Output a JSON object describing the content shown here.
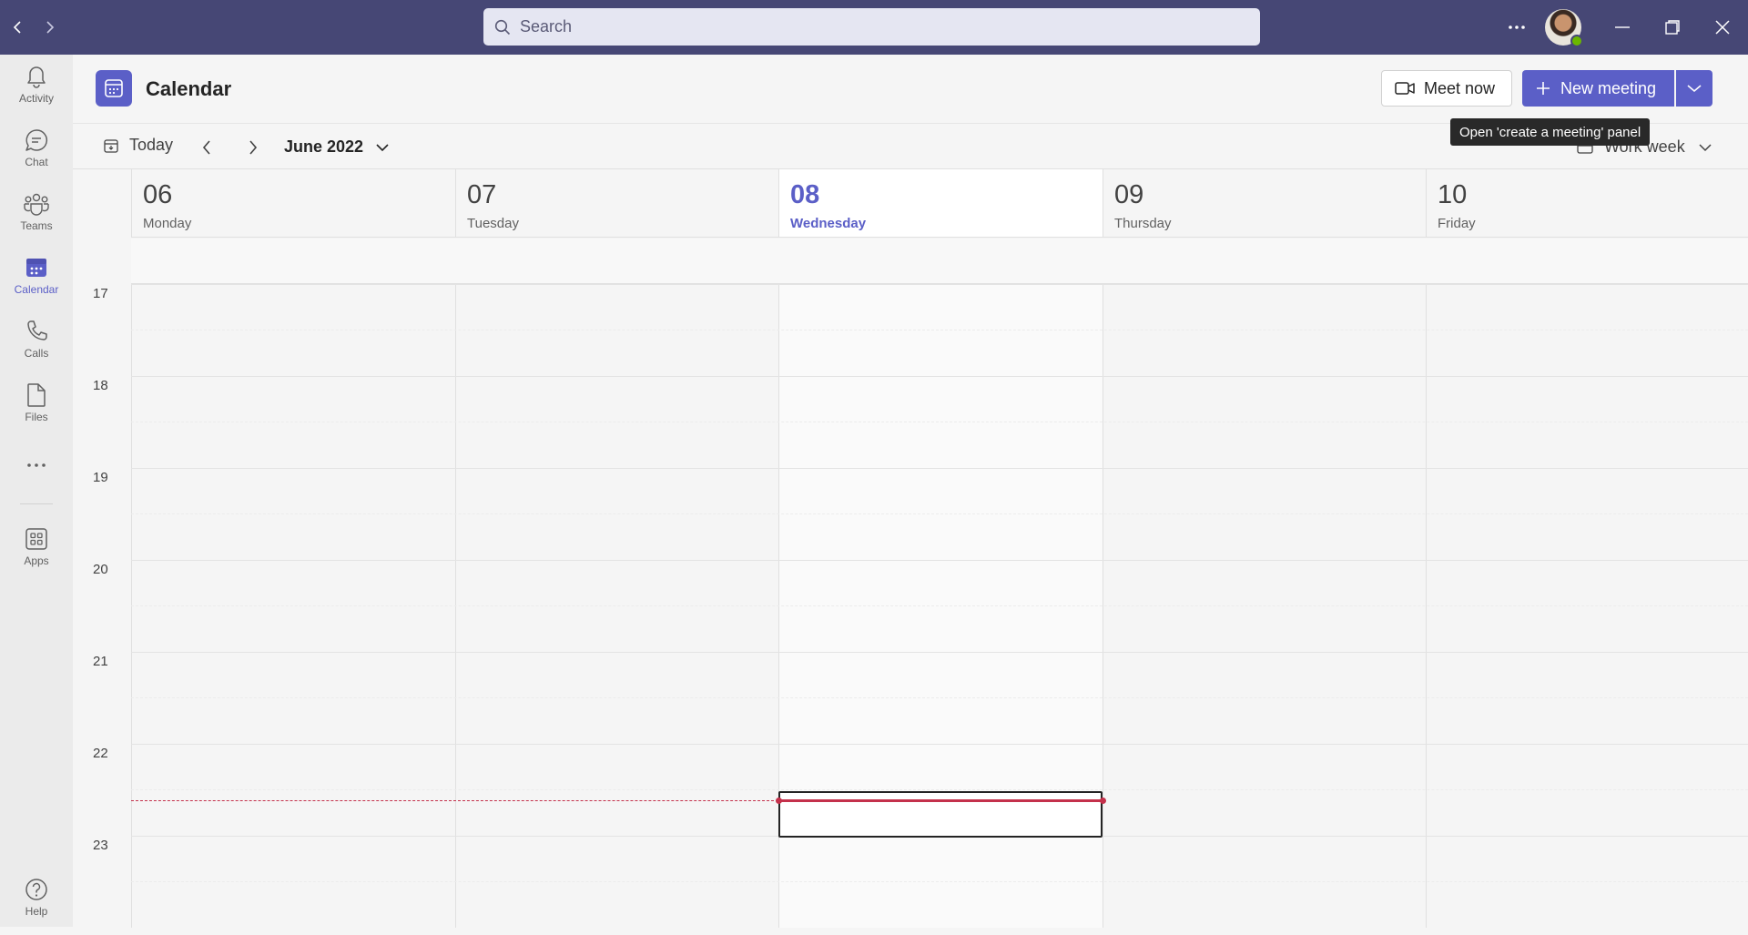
{
  "titlebar": {
    "search_placeholder": "Search",
    "accent": "#464775"
  },
  "rail": {
    "items": [
      {
        "label": "Activity",
        "icon": "bell-icon"
      },
      {
        "label": "Chat",
        "icon": "chat-icon"
      },
      {
        "label": "Teams",
        "icon": "teams-icon"
      },
      {
        "label": "Calendar",
        "icon": "calendar-icon",
        "active": true
      },
      {
        "label": "Calls",
        "icon": "phone-icon"
      },
      {
        "label": "Files",
        "icon": "file-icon"
      },
      {
        "label": "Apps",
        "icon": "apps-icon"
      },
      {
        "label": "Help",
        "icon": "help-icon"
      }
    ]
  },
  "header": {
    "title": "Calendar",
    "meet_now": "Meet now",
    "new_meeting": "New meeting",
    "tooltip": "Open 'create a meeting' panel"
  },
  "toolbar": {
    "today": "Today",
    "month": "June 2022",
    "view": "Work week"
  },
  "days": [
    {
      "num": "06",
      "name": "Monday"
    },
    {
      "num": "07",
      "name": "Tuesday"
    },
    {
      "num": "08",
      "name": "Wednesday",
      "today": true
    },
    {
      "num": "09",
      "name": "Thursday"
    },
    {
      "num": "10",
      "name": "Friday"
    }
  ],
  "hours": [
    "17",
    "18",
    "19",
    "20",
    "21",
    "22",
    "23"
  ],
  "colors": {
    "brand": "#5b5fc7",
    "now_indicator": "#c4314b"
  }
}
